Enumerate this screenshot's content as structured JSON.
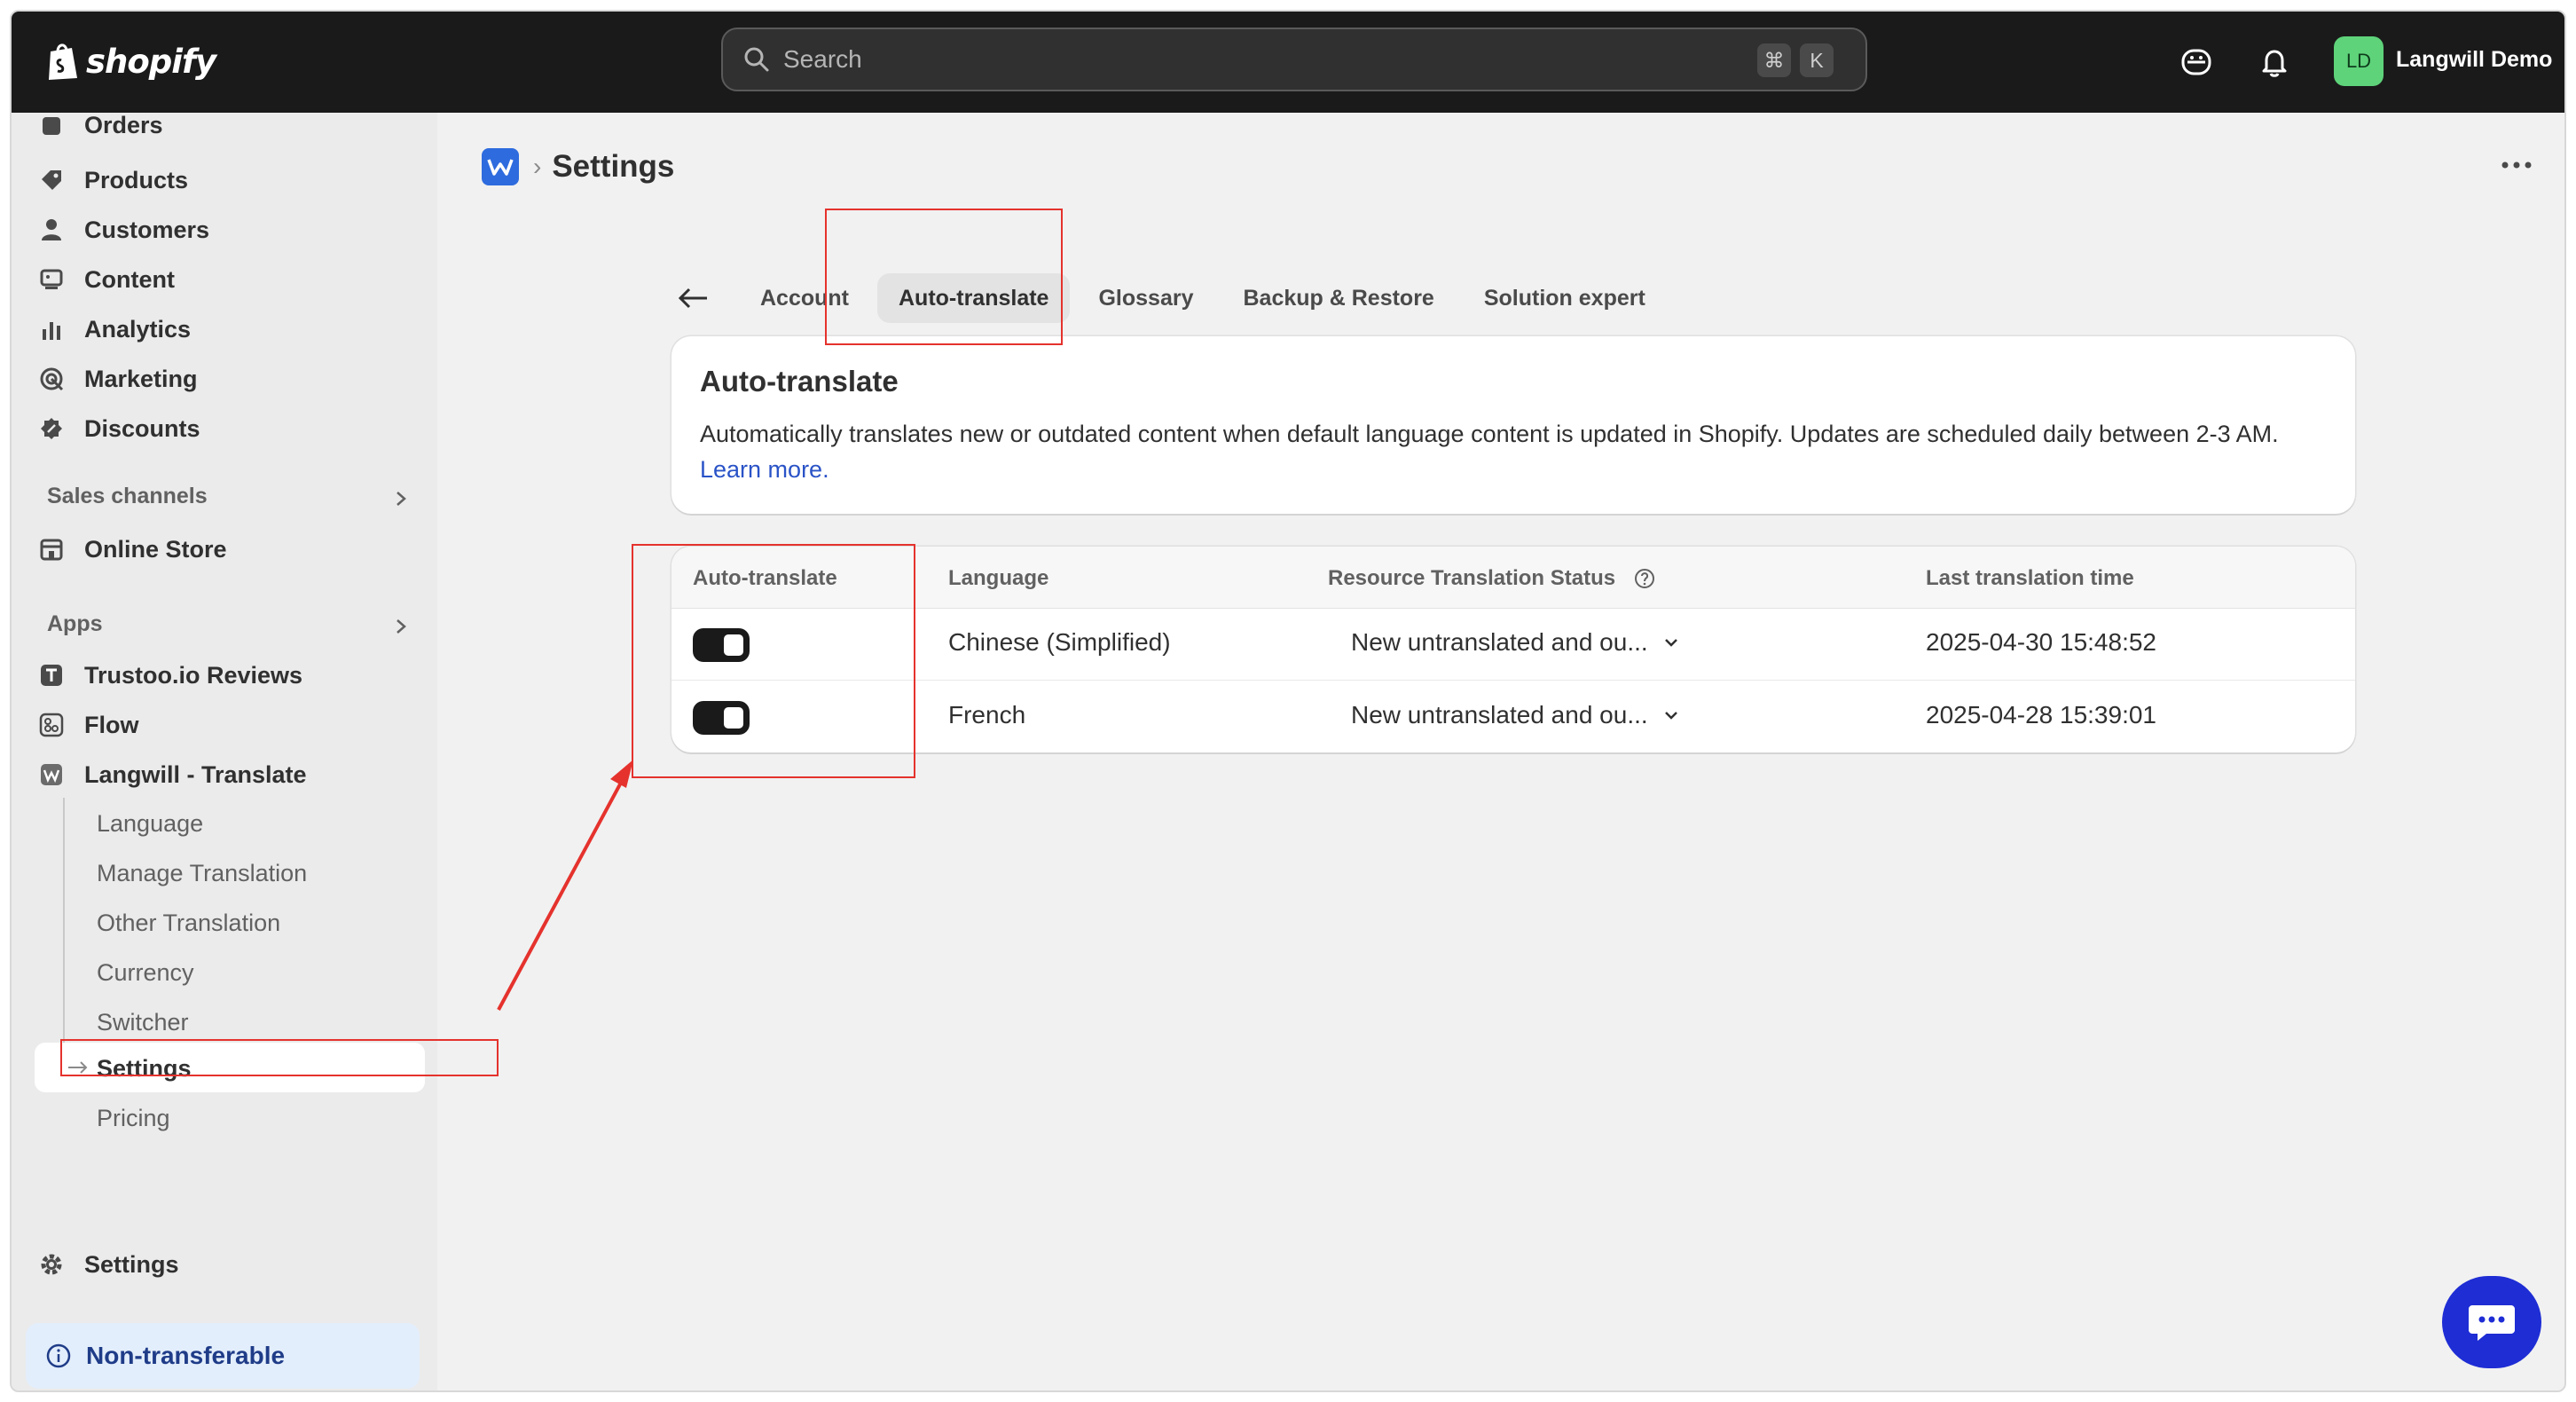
{
  "topbar": {
    "brand": "shopify",
    "search_placeholder": "Search",
    "kbd_cmd": "⌘",
    "kbd_k": "K",
    "user_initials": "LD",
    "user_name": "Langwill Demo"
  },
  "sidebar": {
    "items": [
      {
        "label": "Orders",
        "icon": "orders-icon"
      },
      {
        "label": "Products",
        "icon": "tag-icon"
      },
      {
        "label": "Customers",
        "icon": "person-icon"
      },
      {
        "label": "Content",
        "icon": "content-icon"
      },
      {
        "label": "Analytics",
        "icon": "bar-chart-icon"
      },
      {
        "label": "Marketing",
        "icon": "target-icon"
      },
      {
        "label": "Discounts",
        "icon": "discount-icon"
      }
    ],
    "sales_channels_heading": "Sales channels",
    "online_store": "Online Store",
    "apps_heading": "Apps",
    "apps": [
      {
        "label": "Trustoo.io Reviews",
        "icon": "trustoo-icon"
      },
      {
        "label": "Flow",
        "icon": "flow-icon"
      },
      {
        "label": "Langwill - Translate",
        "icon": "langwill-icon"
      }
    ],
    "sub_items": [
      "Language",
      "Manage Translation",
      "Other Translation",
      "Currency",
      "Switcher",
      "Settings",
      "Pricing"
    ],
    "settings": "Settings",
    "non_transferable": "Non-transferable"
  },
  "page": {
    "title": "Settings",
    "tabs": [
      "Account",
      "Auto-translate",
      "Glossary",
      "Backup & Restore",
      "Solution expert"
    ],
    "active_tab": "Auto-translate"
  },
  "intro": {
    "heading": "Auto-translate",
    "text": "Automatically translates new or outdated content when default language content is updated in Shopify. Updates are scheduled daily between 2-3 AM.",
    "link": "Learn more."
  },
  "table": {
    "headers": [
      "Auto-translate",
      "Language",
      "Resource Translation Status",
      "Last translation time"
    ],
    "rows": [
      {
        "enabled": true,
        "language": "Chinese (Simplified)",
        "status": "New untranslated and ou...",
        "time": "2025-04-30 15:48:52"
      },
      {
        "enabled": true,
        "language": "French",
        "status": "New untranslated and ou...",
        "time": "2025-04-28 15:39:01"
      }
    ]
  },
  "colors": {
    "topbar": "#1a1a1a",
    "accent_link": "#2a53c7",
    "annotation": "#e5322d",
    "chat_button": "#1e2dd4"
  }
}
